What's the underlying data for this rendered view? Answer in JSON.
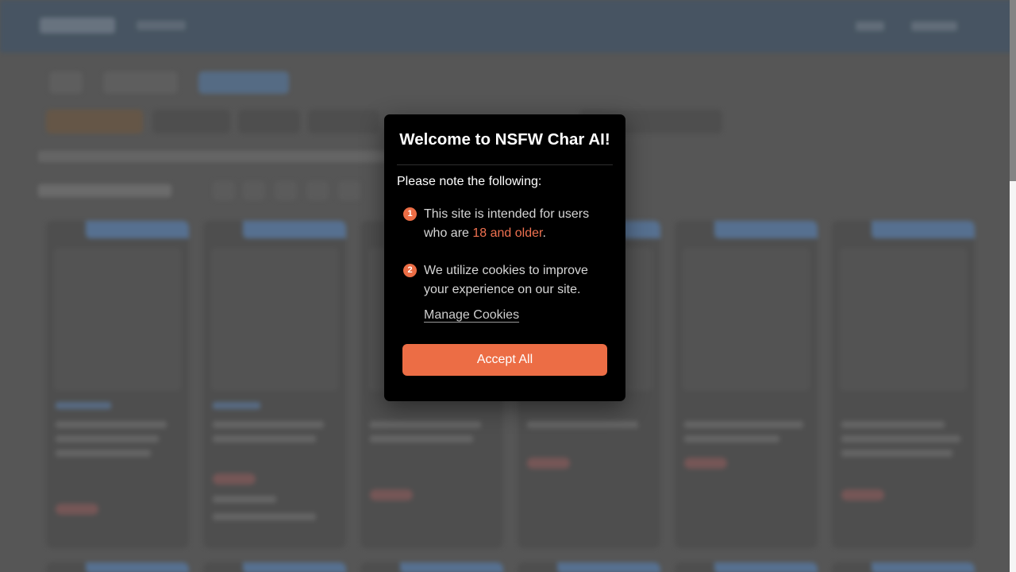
{
  "modal": {
    "title": "Welcome to NSFW Char AI!",
    "intro": "Please note the following:",
    "items": [
      {
        "number": "1",
        "text_before": "This site is intended for users who are ",
        "highlight": "18 and older",
        "text_after": "."
      },
      {
        "number": "2",
        "text": "We utilize cookies to improve your experience on our site."
      }
    ],
    "manage_cookies_label": "Manage Cookies",
    "accept_label": "Accept All"
  },
  "colors": {
    "accent": "#ec6d45",
    "modal_background": "#000000",
    "highlight_text": "#ef7150"
  }
}
